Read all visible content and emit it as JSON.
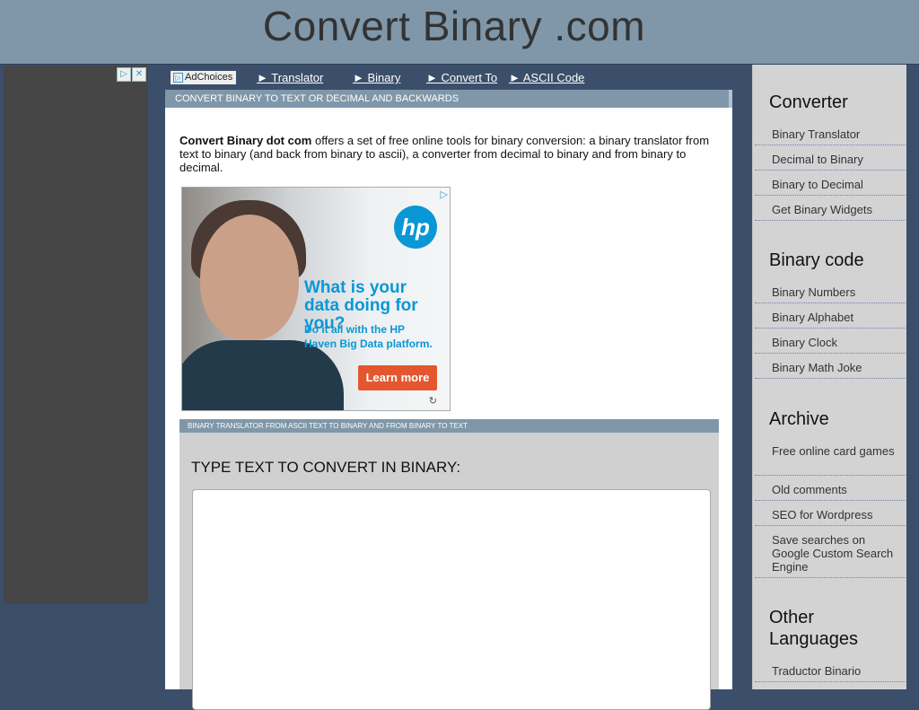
{
  "header": {
    "title": "Convert Binary .com"
  },
  "nav": {
    "adchoices": "AdChoices",
    "links": [
      "► Translator",
      "► Binary",
      "► Convert To",
      "► ASCII Code"
    ]
  },
  "main": {
    "section_title": "CONVERT BINARY TO TEXT OR DECIMAL AND BACKWARDS",
    "intro_bold": "Convert Binary dot com",
    "intro_text": " offers a set of free online tools for binary conversion: a binary translator from text to binary (and back from binary to ascii), a converter from decimal to binary and from binary to decimal."
  },
  "hp_ad": {
    "logo": "hp",
    "headline": "What is your data doing for you?",
    "subline": "Do it all with the HP Haven Big Data platform.",
    "button": "Learn more"
  },
  "translator": {
    "bar": "BINARY TRANSLATOR FROM ASCII TEXT TO BINARY AND FROM BINARY TO TEXT",
    "label": "TYPE TEXT TO CONVERT IN BINARY:"
  },
  "sidebar": {
    "converter_title": "Converter",
    "converter_items": [
      "Binary Translator",
      "Decimal to Binary",
      "Binary to Decimal",
      "Get Binary Widgets"
    ],
    "binary_code_title": "Binary code",
    "binary_code_items": [
      "Binary Numbers",
      "Binary Alphabet",
      "Binary Clock",
      "Binary Math Joke"
    ],
    "archive_title": "Archive",
    "archive_items": [
      "Free online card games",
      "Old comments",
      "SEO for Wordpress",
      "Save searches on Google Custom Search Engine"
    ],
    "other_title": "Other Languages",
    "other_items": [
      "Traductor Binario"
    ]
  }
}
